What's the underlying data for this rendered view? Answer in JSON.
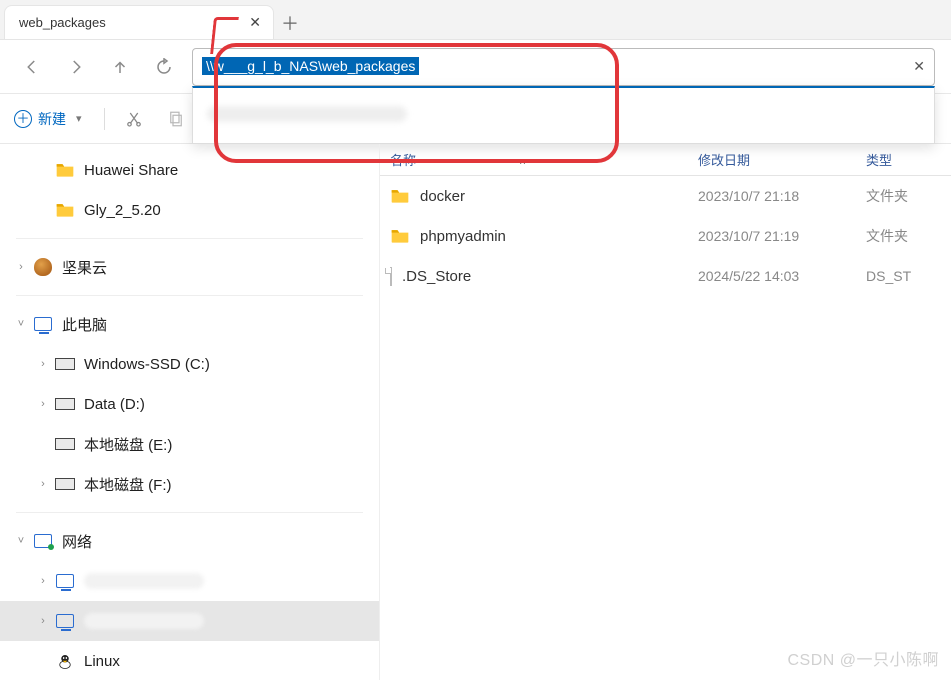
{
  "tab": {
    "title": "web_packages"
  },
  "address": {
    "selected_text": "\\\\w___g_l_b_NAS\\web_packages",
    "suggestion": "\\\\..."
  },
  "toolbar": {
    "new_label": "新建"
  },
  "sidebar": {
    "items": [
      {
        "label": "Huawei Share",
        "kind": "folder",
        "indent": 1,
        "arrow": "none"
      },
      {
        "label": "Gly_2_5.20",
        "kind": "folder",
        "indent": 1,
        "arrow": "none"
      },
      {
        "label": "坚果云",
        "kind": "nut",
        "indent": 0,
        "arrow": "right"
      },
      {
        "label": "此电脑",
        "kind": "pc",
        "indent": 0,
        "arrow": "down"
      },
      {
        "label": "Windows-SSD (C:)",
        "kind": "disk",
        "indent": 1,
        "arrow": "right"
      },
      {
        "label": "Data (D:)",
        "kind": "disk",
        "indent": 1,
        "arrow": "right"
      },
      {
        "label": "本地磁盘 (E:)",
        "kind": "disk",
        "indent": 1,
        "arrow": "none"
      },
      {
        "label": "本地磁盘 (F:)",
        "kind": "disk",
        "indent": 1,
        "arrow": "right"
      },
      {
        "label": "网络",
        "kind": "net",
        "indent": 0,
        "arrow": "down"
      },
      {
        "label": "____________",
        "kind": "pc-remote",
        "indent": 1,
        "arrow": "right",
        "redacted": true
      },
      {
        "label": "____________",
        "kind": "pc-remote",
        "indent": 1,
        "arrow": "right",
        "redacted": true,
        "selected": true
      },
      {
        "label": "Linux",
        "kind": "tux",
        "indent": 1,
        "arrow": "none"
      }
    ]
  },
  "columns": {
    "name": "名称",
    "date": "修改日期",
    "type": "类型"
  },
  "files": [
    {
      "name": "docker",
      "date": "2023/10/7 21:18",
      "type": "文件夹",
      "kind": "folder"
    },
    {
      "name": "phpmyadmin",
      "date": "2023/10/7 21:19",
      "type": "文件夹",
      "kind": "folder"
    },
    {
      "name": ".DS_Store",
      "date": "2024/5/22 14:03",
      "type": "DS_ST",
      "kind": "file"
    }
  ],
  "watermark": "CSDN @一只小陈啊"
}
